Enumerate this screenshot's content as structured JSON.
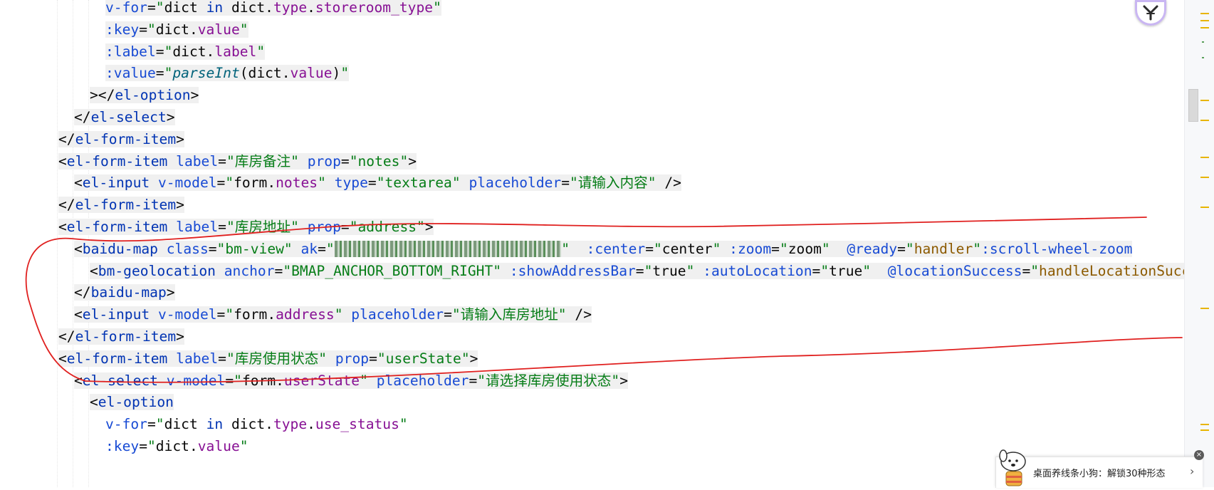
{
  "code_lines": [
    [
      [
        "t-attr",
        "v-for"
      ],
      [
        "t-pun",
        "="
      ],
      [
        "t-str",
        "\""
      ],
      [
        "t-js",
        "dict "
      ],
      [
        "t-kw",
        "in "
      ],
      [
        "t-js",
        "dict."
      ],
      [
        "t-prop",
        "type"
      ],
      [
        "t-js",
        "."
      ],
      [
        "t-prop",
        "storeroom_type"
      ],
      [
        "t-str",
        "\""
      ]
    ],
    [
      [
        "t-attr",
        ":key"
      ],
      [
        "t-pun",
        "="
      ],
      [
        "t-str",
        "\""
      ],
      [
        "t-js",
        "dict."
      ],
      [
        "t-prop",
        "value"
      ],
      [
        "t-str",
        "\""
      ]
    ],
    [
      [
        "t-attr",
        ":label"
      ],
      [
        "t-pun",
        "="
      ],
      [
        "t-str",
        "\""
      ],
      [
        "t-js",
        "dict."
      ],
      [
        "t-prop",
        "label"
      ],
      [
        "t-str",
        "\""
      ]
    ],
    [
      [
        "t-attr",
        ":value"
      ],
      [
        "t-pun",
        "="
      ],
      [
        "t-str",
        "\""
      ],
      [
        "t-fn",
        "parseInt"
      ],
      [
        "t-js",
        "(dict."
      ],
      [
        "t-prop",
        "value"
      ],
      [
        "t-js",
        ")"
      ],
      [
        "t-str",
        "\""
      ]
    ],
    [
      [
        "t-pun",
        "></"
      ],
      [
        "t-tag",
        "el-option"
      ],
      [
        "t-pun",
        ">"
      ]
    ],
    [
      [
        "t-pun",
        "</"
      ],
      [
        "t-tag",
        "el-select"
      ],
      [
        "t-pun",
        ">"
      ]
    ],
    [
      [
        "t-pun",
        "</"
      ],
      [
        "t-tag",
        "el-form-item"
      ],
      [
        "t-pun",
        ">"
      ]
    ],
    [
      [
        "t-pun",
        "<"
      ],
      [
        "t-tag",
        "el-form-item "
      ],
      [
        "t-attr",
        "label"
      ],
      [
        "t-pun",
        "="
      ],
      [
        "t-str",
        "\"库房备注\" "
      ],
      [
        "t-attr",
        "prop"
      ],
      [
        "t-pun",
        "="
      ],
      [
        "t-str",
        "\"notes\""
      ],
      [
        "t-pun",
        ">"
      ]
    ],
    [
      [
        "t-pun",
        "<"
      ],
      [
        "t-tag",
        "el-input "
      ],
      [
        "t-attr",
        "v-model"
      ],
      [
        "t-pun",
        "="
      ],
      [
        "t-str",
        "\""
      ],
      [
        "t-js",
        "form."
      ],
      [
        "t-prop",
        "notes"
      ],
      [
        "t-str",
        "\" "
      ],
      [
        "t-attr",
        "type"
      ],
      [
        "t-pun",
        "="
      ],
      [
        "t-str",
        "\"textarea\" "
      ],
      [
        "t-attr",
        "placeholder"
      ],
      [
        "t-pun",
        "="
      ],
      [
        "t-str",
        "\"请输入内容\" "
      ],
      [
        "t-pun",
        "/>"
      ]
    ],
    [
      [
        "t-pun",
        "</"
      ],
      [
        "t-tag",
        "el-form-item"
      ],
      [
        "t-pun",
        ">"
      ]
    ],
    [
      [
        "t-pun",
        "<"
      ],
      [
        "t-tag",
        "el-form-item "
      ],
      [
        "t-attr",
        "label"
      ],
      [
        "t-pun",
        "="
      ],
      [
        "t-str",
        "\"库房地址\" "
      ],
      [
        "t-attr",
        "prop"
      ],
      [
        "t-pun",
        "="
      ],
      [
        "t-str",
        "\"address\""
      ],
      [
        "t-pun",
        ">"
      ]
    ],
    [
      [
        "t-pun",
        "<"
      ],
      [
        "t-tag",
        "baidu-map "
      ],
      [
        "t-attr",
        "class"
      ],
      [
        "t-pun",
        "="
      ],
      [
        "t-str",
        "\"bm-view\" "
      ],
      [
        "t-attr",
        "ak"
      ],
      [
        "t-pun",
        "="
      ],
      [
        "t-str",
        "\""
      ],
      [
        "t-blur",
        "xxxxxxxxxxxxxxxxxxxxxxxxxxx"
      ],
      [
        "t-str",
        "\"  "
      ],
      [
        "t-attr",
        ":center"
      ],
      [
        "t-pun",
        "="
      ],
      [
        "t-str",
        "\""
      ],
      [
        "t-js",
        "center"
      ],
      [
        "t-str",
        "\" "
      ],
      [
        "t-attr",
        ":zoom"
      ],
      [
        "t-pun",
        "="
      ],
      [
        "t-str",
        "\""
      ],
      [
        "t-js",
        "zoom"
      ],
      [
        "t-str",
        "\"  "
      ],
      [
        "t-attr",
        "@ready"
      ],
      [
        "t-pun",
        "="
      ],
      [
        "t-str",
        "\""
      ],
      [
        "t-method",
        "handler"
      ],
      [
        "t-str",
        "\""
      ],
      [
        "t-attr",
        ":scroll-wheel-zoom"
      ]
    ],
    [
      [
        "t-pun",
        "<"
      ],
      [
        "t-tag",
        "bm-geolocation "
      ],
      [
        "t-attr",
        "anchor"
      ],
      [
        "t-pun",
        "="
      ],
      [
        "t-str",
        "\"BMAP_ANCHOR_BOTTOM_RIGHT\" "
      ],
      [
        "t-attr",
        ":showAddressBar"
      ],
      [
        "t-pun",
        "="
      ],
      [
        "t-str",
        "\""
      ],
      [
        "t-js",
        "true"
      ],
      [
        "t-str",
        "\" "
      ],
      [
        "t-attr",
        ":autoLocation"
      ],
      [
        "t-pun",
        "="
      ],
      [
        "t-str",
        "\""
      ],
      [
        "t-js",
        "true"
      ],
      [
        "t-str",
        "\"  "
      ],
      [
        "t-attr",
        "@locationSuccess"
      ],
      [
        "t-pun",
        "="
      ],
      [
        "t-str",
        "\""
      ],
      [
        "t-method",
        "handleLocationSuccess"
      ]
    ],
    [
      [
        "t-pun",
        "</"
      ],
      [
        "t-tag",
        "baidu-map"
      ],
      [
        "t-pun",
        ">"
      ]
    ],
    [
      [
        "t-pun",
        "<"
      ],
      [
        "t-tag",
        "el-input "
      ],
      [
        "t-attr",
        "v-model"
      ],
      [
        "t-pun",
        "="
      ],
      [
        "t-str",
        "\""
      ],
      [
        "t-js",
        "form."
      ],
      [
        "t-prop",
        "address"
      ],
      [
        "t-str",
        "\" "
      ],
      [
        "t-attr",
        "placeholder"
      ],
      [
        "t-pun",
        "="
      ],
      [
        "t-str",
        "\"请输入库房地址\" "
      ],
      [
        "t-pun",
        "/>"
      ]
    ],
    [
      [
        "t-pun",
        "</"
      ],
      [
        "t-tag",
        "el-form-item"
      ],
      [
        "t-pun",
        ">"
      ]
    ],
    [
      [
        "t-pun",
        "<"
      ],
      [
        "t-tag",
        "el-form-item "
      ],
      [
        "t-attr",
        "label"
      ],
      [
        "t-pun",
        "="
      ],
      [
        "t-str",
        "\"库房使用状态\" "
      ],
      [
        "t-attr",
        "prop"
      ],
      [
        "t-pun",
        "="
      ],
      [
        "t-str",
        "\"userState\""
      ],
      [
        "t-pun",
        ">"
      ]
    ],
    [
      [
        "t-pun",
        "<"
      ],
      [
        "t-tag",
        "el-select "
      ],
      [
        "t-attr",
        "v-model"
      ],
      [
        "t-pun",
        "="
      ],
      [
        "t-str",
        "\""
      ],
      [
        "t-js",
        "form."
      ],
      [
        "t-prop",
        "userState"
      ],
      [
        "t-str",
        "\" "
      ],
      [
        "t-attr",
        "placeholder"
      ],
      [
        "t-pun",
        "="
      ],
      [
        "t-str",
        "\"请选择库房使用状态\""
      ],
      [
        "t-pun",
        ">"
      ]
    ],
    [
      [
        "t-pun",
        "<"
      ],
      [
        "t-tag",
        "el-option"
      ]
    ],
    [
      [
        "t-attr",
        "v-for"
      ],
      [
        "t-pun",
        "="
      ],
      [
        "t-str",
        "\""
      ],
      [
        "t-js",
        "dict "
      ],
      [
        "t-kw",
        "in "
      ],
      [
        "t-js",
        "dict."
      ],
      [
        "t-prop",
        "type"
      ],
      [
        "t-js",
        "."
      ],
      [
        "t-prop",
        "use_status"
      ],
      [
        "t-str",
        "\""
      ]
    ],
    [
      [
        "t-attr",
        ":key"
      ],
      [
        "t-pun",
        "="
      ],
      [
        "t-str",
        "\""
      ],
      [
        "t-js",
        "dict."
      ],
      [
        "t-prop",
        "value"
      ],
      [
        "t-str",
        "\""
      ]
    ]
  ],
  "notification": {
    "text": "桌面养线条小狗：解锁30种形态",
    "arrow": "›",
    "close": "×"
  },
  "icons": {
    "ai_assistant": "ai-assistant-icon",
    "dog": "dog-mascot-icon"
  }
}
